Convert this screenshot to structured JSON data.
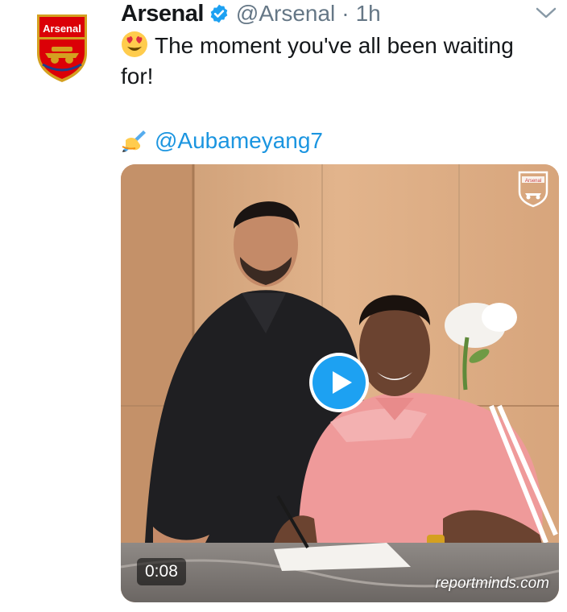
{
  "tweet": {
    "author_name": "Arsenal",
    "avatar_text": "Arsenal",
    "handle": "@Arsenal",
    "separator": "·",
    "time": "1h",
    "text_line1": "The moment you've all been waiting",
    "text_line2": "for!",
    "mention": "@Aubameyang7",
    "icons": {
      "verified": "verified-badge-icon",
      "more": "chevron-down-icon",
      "emoji_1": "heart-eyes-emoji",
      "emoji_2": "writing-hand-emoji",
      "play": "play-icon"
    }
  },
  "media": {
    "duration": "0:08",
    "watermark": "reportminds.com",
    "crest_text": "Arsenal"
  },
  "colors": {
    "link": "#1b95e0",
    "verified": "#1da1f2",
    "text": "#14171a",
    "muted": "#657786",
    "arsenal_red": "#db0007"
  }
}
